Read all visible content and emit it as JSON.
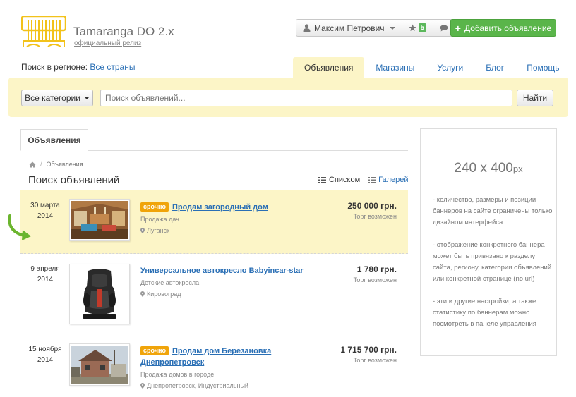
{
  "brand": {
    "name": "Tamaranga DO 2.x",
    "subtitle": "официальный релиз",
    "accent": "#f2c21b"
  },
  "userbar": {
    "user_name": "Максим Петрович",
    "favorites_count": "5"
  },
  "add_button": {
    "label": "Добавить объявление",
    "color": "#5ab54a"
  },
  "region": {
    "label": "Поиск в регионе:",
    "value": "Все страны"
  },
  "nav": {
    "tabs": [
      "Объявления",
      "Магазины",
      "Услуги",
      "Блог",
      "Помощь"
    ],
    "active": "Объявления"
  },
  "search": {
    "category_label": "Все категории",
    "placeholder": "Поиск объявлений...",
    "button_label": "Найти"
  },
  "content": {
    "tab": "Объявления",
    "breadcrumb": "Объявления",
    "title": "Поиск объявлений",
    "view_list": "Списком",
    "view_gallery": "Галерей"
  },
  "listings": [
    {
      "day": "30 марта",
      "year": "2014",
      "urgent": "срочно",
      "title": "Продам загородный дом",
      "category": "Продажа дач",
      "location": "Луганск",
      "price": "250 000 грн.",
      "bargain": "Торг возможен",
      "image": "house-interior",
      "highlighted": true
    },
    {
      "day": "9 апреля",
      "year": "2014",
      "urgent": "",
      "title": "Универсальное автокресло Babyincar-star",
      "category": "Детские автокресла",
      "location": "Кировоград",
      "price": "1 780 грн.",
      "bargain": "Торг возможен",
      "image": "car-seat",
      "highlighted": false
    },
    {
      "day": "15 ноября",
      "year": "2014",
      "urgent": "срочно",
      "title": "Продам дом Березановка Днепропетровск",
      "category": "Продажа домов в городе",
      "location": "Днепропетровск, Индустриальный",
      "price": "1 715 700 грн.",
      "bargain": "Торг возможен",
      "image": "house-exterior",
      "highlighted": false
    }
  ],
  "banner": {
    "size": "240 x 400",
    "unit": "px",
    "notes": [
      "- количество, размеры и позиции баннеров на сайте ограничены только дизайном интерфейса",
      "- отображение конкретного баннера может быть привязано к разделу сайта, региону, категории объявлений или конкретной странице (no url)",
      "- эти и другие настройки, а также статистику по баннерам можно посмотреть в панеле управления"
    ]
  }
}
